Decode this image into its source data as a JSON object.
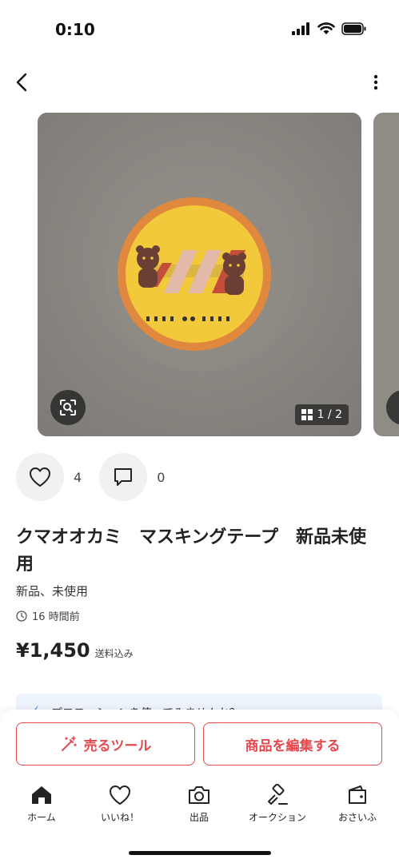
{
  "status_bar": {
    "time": "0:10"
  },
  "carousel": {
    "page_counter": "1 / 2"
  },
  "reactions": {
    "likes": "4",
    "comments": "0"
  },
  "item": {
    "title": "クマオオカミ　マスキングテープ　新品未使用",
    "condition": "新品、未使用",
    "posted": "16 時間前",
    "price": "¥1,450",
    "price_note": "送料込み"
  },
  "promo": {
    "text": "プロモーションを使ってみませんか？"
  },
  "actions": {
    "sell_tools": "売るツール",
    "edit": "商品を編集する"
  },
  "tabs": [
    {
      "label": "ホーム",
      "icon": "home-icon"
    },
    {
      "label": "いいね！",
      "icon": "heart-icon"
    },
    {
      "label": "出品",
      "icon": "camera-icon"
    },
    {
      "label": "オークション",
      "icon": "gavel-icon"
    },
    {
      "label": "おさいふ",
      "icon": "wallet-icon"
    }
  ],
  "colors": {
    "accent": "#e5484d",
    "background": "#ffffff"
  }
}
